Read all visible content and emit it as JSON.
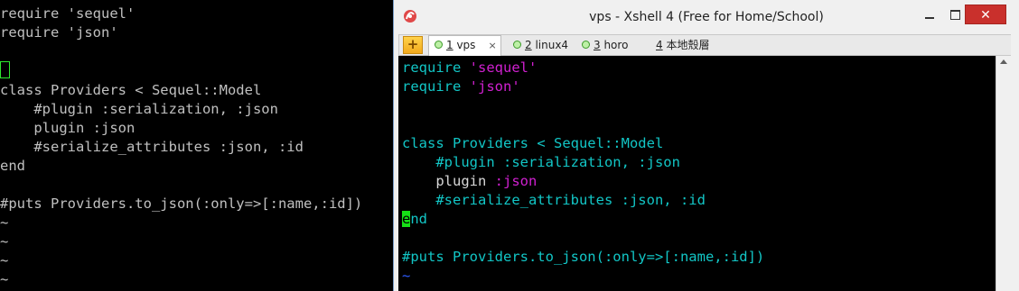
{
  "left_terminal": {
    "lines": [
      [
        "require 'sequel'"
      ],
      [
        "require 'json'"
      ],
      [
        ""
      ],
      [
        ""
      ],
      [
        "class Providers < Sequel::Model"
      ],
      [
        "    #plugin :serialization, :json"
      ],
      [
        "    plugin :json"
      ],
      [
        "    #serialize_attributes :json, :id"
      ],
      [
        "end"
      ],
      [
        ""
      ],
      [
        "#puts Providers.to_json(:only=>[:name,:id])"
      ],
      [
        "~"
      ],
      [
        "~"
      ],
      [
        "~"
      ],
      [
        "~"
      ]
    ]
  },
  "xshell": {
    "window_title": "vps - Xshell 4 (Free for Home/School)",
    "close_symbol": "✕",
    "tabs": [
      {
        "num": "1",
        "label": " vps"
      },
      {
        "num": "2",
        "label": " linux4"
      },
      {
        "num": "3",
        "label": " horo"
      },
      {
        "num": "4",
        "label": " 本地殼層"
      }
    ],
    "tab_close": "×",
    "add_tab_symbol": "+",
    "code": {
      "l1_kw": "require ",
      "l1_str": "'sequel'",
      "l2_kw": "require ",
      "l2_str": "'json'",
      "l5_kw": "class ",
      "l5_const": "Providers < Sequel::Model",
      "l6": "    #plugin :serialization, :json",
      "l7_text": "    plugin ",
      "l7_str": ":json",
      "l8": "    #serialize_attributes :json, :id",
      "l9_cursor": "e",
      "l9_rest": "nd",
      "l11": "#puts Providers.to_json(:only=>[:name,:id])",
      "l12": "~"
    }
  },
  "colors": {
    "accent_close": "#c9302c",
    "terminal_bg": "#000000",
    "cyan": "#12c6c6",
    "magenta": "#d020d0",
    "cursor_green": "#16e016"
  }
}
